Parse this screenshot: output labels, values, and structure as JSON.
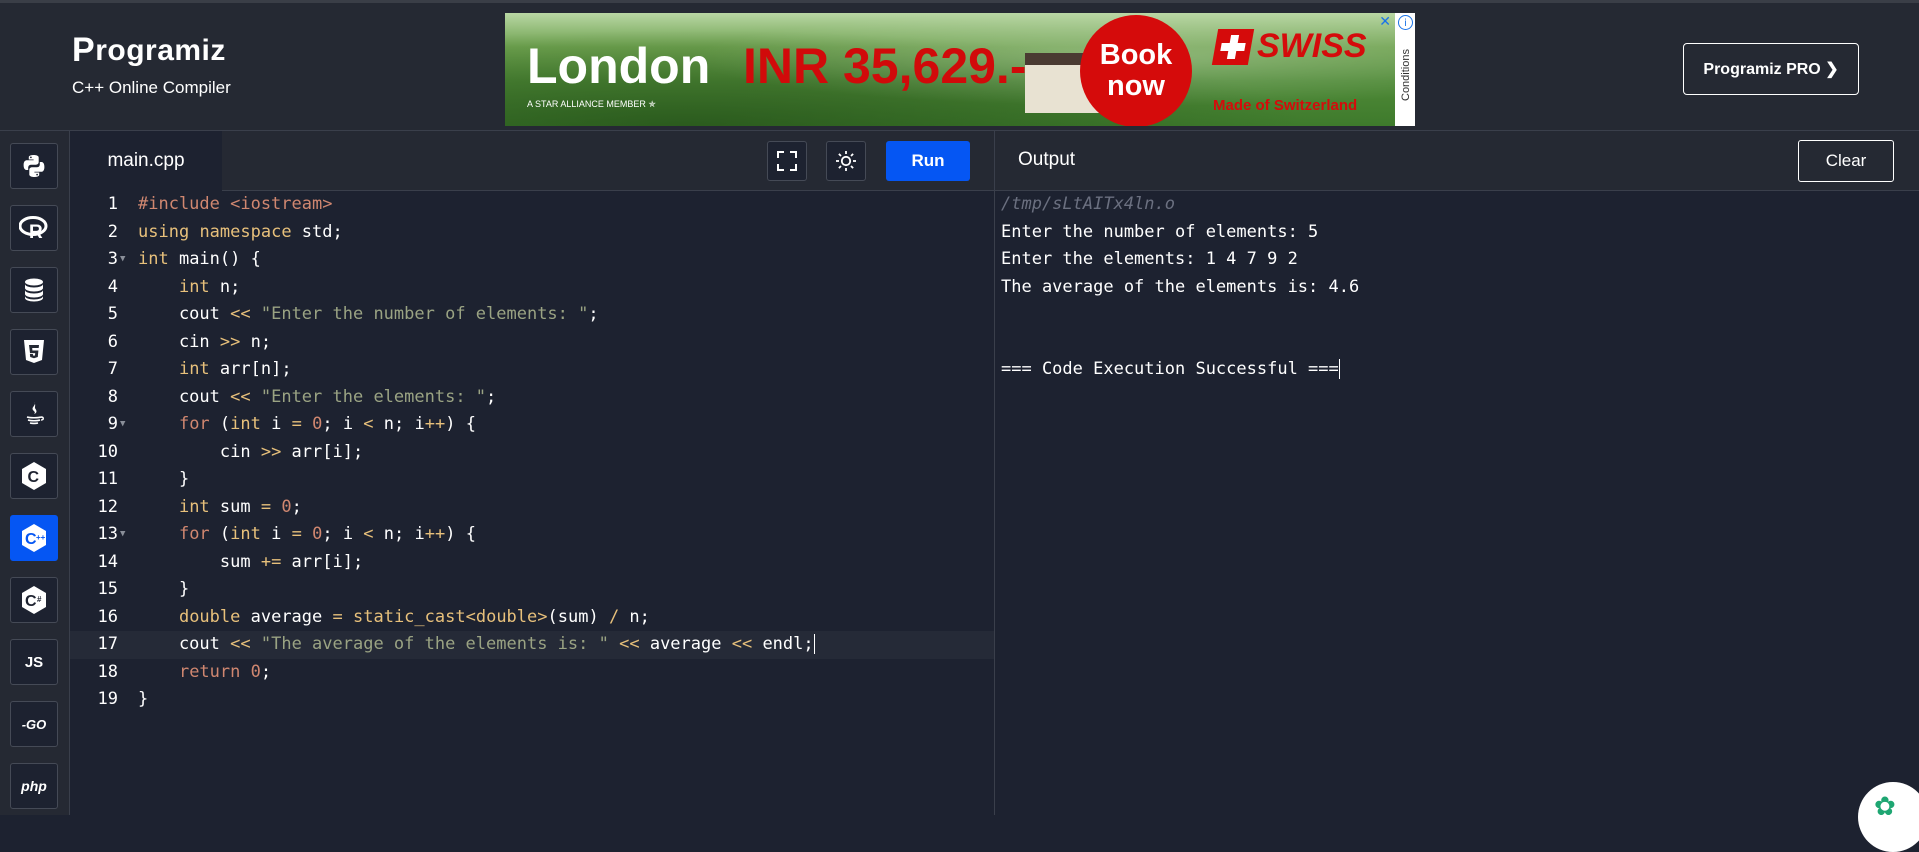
{
  "header": {
    "logo_text": "rogramiz",
    "logo_mark": "P",
    "subtitle": "C++ Online Compiler",
    "pro_button": "Programiz PRO ❯"
  },
  "ad": {
    "city": "London",
    "price": "INR 35,629.-",
    "book_now": "Book now",
    "airline": "SWISS",
    "made_of": "Made of Switzerland",
    "alliance": "A STAR ALLIANCE MEMBER ✯",
    "conditions": "Conditions",
    "info_icon": "info-icon",
    "close_icon": "close-icon"
  },
  "sidebar": {
    "items": [
      {
        "name": "python",
        "label": "",
        "icon": "python-icon"
      },
      {
        "name": "r",
        "label": "R",
        "icon": "r-icon"
      },
      {
        "name": "sql",
        "label": "",
        "icon": "database-icon"
      },
      {
        "name": "html",
        "label": "5",
        "icon": "html5-icon"
      },
      {
        "name": "java",
        "label": "",
        "icon": "java-icon"
      },
      {
        "name": "c",
        "label": "C",
        "icon": "c-icon"
      },
      {
        "name": "cpp",
        "label": "C",
        "icon": "cpp-icon",
        "active": true
      },
      {
        "name": "csharp",
        "label": "C",
        "icon": "csharp-icon"
      },
      {
        "name": "js",
        "label": "JS",
        "icon": "js-icon"
      },
      {
        "name": "go",
        "label": "-GO",
        "icon": "go-icon"
      },
      {
        "name": "php",
        "label": "php",
        "icon": "php-icon"
      }
    ]
  },
  "editor": {
    "file_tab": "main.cpp",
    "run_label": "Run",
    "current_line": 17,
    "line_numbers": [
      "1",
      "2",
      "3",
      "4",
      "5",
      "6",
      "7",
      "8",
      "9",
      "10",
      "11",
      "12",
      "13",
      "14",
      "15",
      "16",
      "17",
      "18",
      "19"
    ],
    "lines": [
      "#include <iostream>",
      "using namespace std;",
      "int main() {",
      "    int n;",
      "    cout << \"Enter the number of elements: \";",
      "    cin >> n;",
      "    int arr[n];",
      "    cout << \"Enter the elements: \";",
      "    for (int i = 0; i < n; i++) {",
      "        cin >> arr[i];",
      "    }",
      "    int sum = 0;",
      "    for (int i = 0; i < n; i++) {",
      "        sum += arr[i];",
      "    }",
      "    double average = static_cast<double>(sum) / n;",
      "    cout << \"The average of the elements is: \" << average << endl;",
      "    return 0;",
      "}"
    ]
  },
  "output": {
    "title": "Output",
    "clear_label": "Clear",
    "path": "/tmp/sLtAITx4ln.o",
    "lines": [
      "Enter the number of elements: 5",
      "Enter the elements: 1 4 7 9 2",
      "The average of the elements is: 4.6",
      "",
      "",
      "=== Code Execution Successful ==="
    ]
  },
  "colors": {
    "background": "#1d2230",
    "panel": "#252933",
    "accent": "#0556f3",
    "keyword": "#e7c07b",
    "string": "#9aa383",
    "number": "#d08770"
  }
}
